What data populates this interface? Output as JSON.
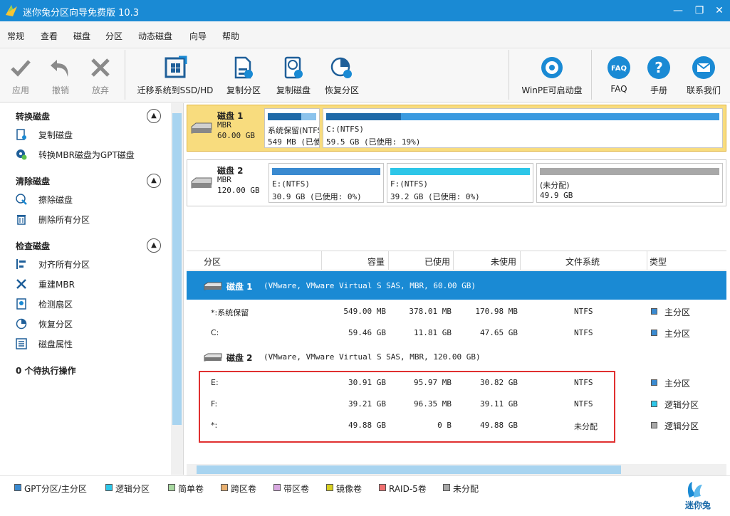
{
  "window": {
    "title": "迷你兔分区向导免费版 10.3",
    "min_label": "—",
    "max_label": "❐",
    "close_label": "✕"
  },
  "menu": [
    "常规",
    "查看",
    "磁盘",
    "分区",
    "动态磁盘",
    "向导",
    "帮助"
  ],
  "toolbar": {
    "apply": "应用",
    "undo": "撤销",
    "discard": "放弃",
    "migrate": "迁移系统到SSD/HD",
    "copy_partition": "复制分区",
    "copy_disk": "复制磁盘",
    "recover_partition": "恢复分区",
    "winpe": "WinPE可启动盘",
    "faq": "FAQ",
    "manual": "手册",
    "contact": "联系我们"
  },
  "left": {
    "sections": [
      {
        "title": "转换磁盘",
        "items": [
          "复制磁盘",
          "转换MBR磁盘为GPT磁盘"
        ]
      },
      {
        "title": "清除磁盘",
        "items": [
          "擦除磁盘",
          "删除所有分区"
        ]
      },
      {
        "title": "检查磁盘",
        "items": [
          "对齐所有分区",
          "重建MBR",
          "检测扇区",
          "恢复分区",
          "磁盘属性"
        ]
      }
    ],
    "pending": "0 个待执行操作"
  },
  "disks": [
    {
      "name": "磁盘 1",
      "type": "MBR",
      "size": "60.00 GB",
      "partitions": [
        {
          "label": "系统保留(NTFS)",
          "detail": "549 MB (已使用: 68%)",
          "used_fraction": 0.69
        },
        {
          "label": "C:(NTFS)",
          "detail": "59.5 GB (已使用: 19%)",
          "used_fraction": 0.19
        }
      ]
    },
    {
      "name": "磁盘 2",
      "type": "MBR",
      "size": "120.00 GB",
      "partitions": [
        {
          "label": "E:(NTFS)",
          "detail": "30.9 GB (已使用: 0%)",
          "used_fraction": 0.0
        },
        {
          "label": "F:(NTFS)",
          "detail": "39.2 GB (已使用: 0%)",
          "used_fraction": 0.0
        },
        {
          "label": "(未分配)",
          "detail": "49.9 GB",
          "used_fraction": 0.0
        }
      ]
    }
  ],
  "table": {
    "headers": [
      "分区",
      "容量",
      "已使用",
      "未使用",
      "文件系统",
      "类型"
    ],
    "groups": [
      {
        "name": "磁盘 1",
        "info": "(VMware, VMware Virtual S SAS, MBR, 60.00 GB)",
        "rows": [
          {
            "name": "*:系统保留",
            "capacity": "549.00 MB",
            "used": "378.01 MB",
            "free": "170.98 MB",
            "fs": "NTFS",
            "type": "主分区"
          },
          {
            "name": "C:",
            "capacity": "59.46 GB",
            "used": "11.81 GB",
            "free": "47.65 GB",
            "fs": "NTFS",
            "type": "主分区"
          }
        ]
      },
      {
        "name": "磁盘 2",
        "info": "(VMware, VMware Virtual S SAS, MBR, 120.00 GB)",
        "rows": [
          {
            "name": "E:",
            "capacity": "30.91 GB",
            "used": "95.97 MB",
            "free": "30.82 GB",
            "fs": "NTFS",
            "type": "主分区"
          },
          {
            "name": "F:",
            "capacity": "39.21 GB",
            "used": "96.35 MB",
            "free": "39.11 GB",
            "fs": "NTFS",
            "type": "逻辑分区"
          },
          {
            "name": "*:",
            "capacity": "49.88 GB",
            "used": "0 B",
            "free": "49.88 GB",
            "fs": "未分配",
            "type": "逻辑分区"
          }
        ]
      }
    ]
  },
  "legend": [
    {
      "label": "GPT分区/主分区",
      "color": "#3a8ad0"
    },
    {
      "label": "逻辑分区",
      "color": "#2ec6e8"
    },
    {
      "label": "简单卷",
      "color": "#a8d8a0"
    },
    {
      "label": "跨区卷",
      "color": "#e8b070"
    },
    {
      "label": "带区卷",
      "color": "#d8a8e0"
    },
    {
      "label": "镜像卷",
      "color": "#d8d020"
    },
    {
      "label": "RAID-5卷",
      "color": "#f07070"
    },
    {
      "label": "未分配",
      "color": "#a8a8a8"
    }
  ],
  "brand": "迷你兔",
  "colors": {
    "accent": "#1a8ad4",
    "primary": "#3a8ad0",
    "logical": "#2ec6e8",
    "unallocated": "#a8a8a8",
    "selection": "#f8dc7e",
    "highlight": "#e03030"
  }
}
